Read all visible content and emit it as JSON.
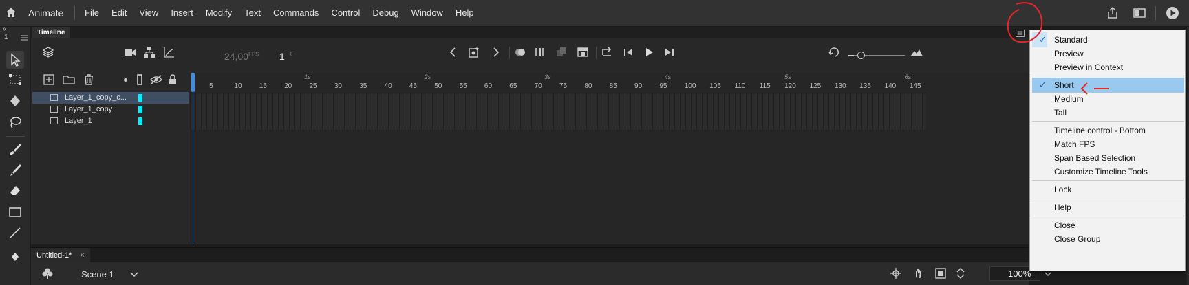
{
  "app": {
    "name": "Animate"
  },
  "menu": [
    "File",
    "Edit",
    "View",
    "Insert",
    "Modify",
    "Text",
    "Commands",
    "Control",
    "Debug",
    "Window",
    "Help"
  ],
  "panel": {
    "tab": "Timeline"
  },
  "toolbar_collapse": {
    "arrows": "«",
    "number": "1"
  },
  "controls": {
    "fps_value": "24,00",
    "fps_unit": "FPS",
    "frame": "1",
    "frame_unit": "F"
  },
  "layers": [
    {
      "name": "Layer_1_copy_c...",
      "selected": true
    },
    {
      "name": "Layer_1_copy",
      "selected": false
    },
    {
      "name": "Layer_1",
      "selected": false
    }
  ],
  "ruler": {
    "ticks": [
      "5",
      "10",
      "15",
      "20",
      "25",
      "30",
      "35",
      "40",
      "45",
      "50",
      "55",
      "60",
      "65",
      "70",
      "75",
      "80",
      "85",
      "90",
      "95",
      "100",
      "105",
      "110",
      "115",
      "120",
      "125",
      "130",
      "135",
      "140",
      "145"
    ],
    "seconds": [
      "1s",
      "2s",
      "3s",
      "4s",
      "5s",
      "6s"
    ]
  },
  "document": {
    "tab": "Untitled-1*",
    "close": "×"
  },
  "stage": {
    "scene": "Scene 1",
    "zoom": "100%"
  },
  "dropdown": {
    "items": [
      {
        "label": "Standard",
        "checked": true
      },
      {
        "label": "Preview",
        "checked": false
      },
      {
        "label": "Preview in Context",
        "checked": false
      },
      {
        "label": "Short",
        "checked": true,
        "highlighted": true
      },
      {
        "label": "Medium",
        "checked": false
      },
      {
        "label": "Tall",
        "checked": false
      },
      {
        "label": "Timeline control - Bottom",
        "checked": false
      },
      {
        "label": "Match FPS",
        "checked": false
      },
      {
        "label": "Span Based Selection",
        "checked": false
      },
      {
        "label": "Customize Timeline Tools",
        "checked": false
      },
      {
        "label": "Lock",
        "checked": false
      },
      {
        "label": "Help",
        "checked": false
      },
      {
        "label": "Close",
        "checked": false
      },
      {
        "label": "Close Group",
        "checked": false
      }
    ],
    "checkmark": "✓"
  },
  "colors": {
    "layer_color": "#00f0ff",
    "playhead": "#3d8de6",
    "highlight": "#99c9ef",
    "annotation": "#e8262a"
  }
}
